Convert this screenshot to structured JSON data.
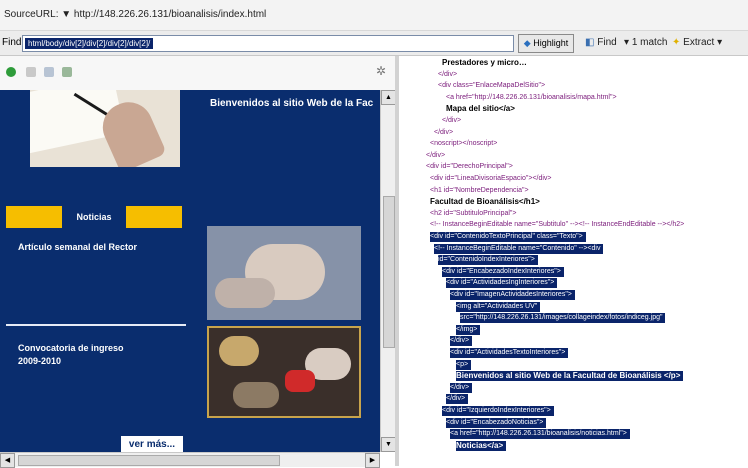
{
  "toolbar": {
    "source_label": "SourceURL: ▼ http://148.226.26.131/bioanalisis/index.html",
    "find_label": "Find",
    "find_value": "html/body/div[2]/div[2]/div[2]/div[2]/",
    "highlight_label": "Highlight",
    "find_button_label": "Find",
    "match_count": "1 match",
    "extract_label": "Extract"
  },
  "site": {
    "welcome": "Bienvenidos al sitio Web de la Fac",
    "news_label": "Noticias",
    "article_title": "Artículo semanal del Rector",
    "convocatoria_line1": "Convocatoria de ingreso",
    "convocatoria_line2": "2009-2010",
    "more_link": "ver más..."
  },
  "source_lines": [
    {
      "text": "Prestadores y micro…",
      "indent": 42,
      "bold": true,
      "hl": false
    },
    {
      "text": "</div>",
      "indent": 38,
      "bold": false,
      "hl": false
    },
    {
      "text": "<div class=\"EnlaceMapaDelSitio\">",
      "indent": 38,
      "bold": false,
      "hl": false
    },
    {
      "text": "<a href=\"http://148.226.26.131/bioanalisis/mapa.html\">",
      "indent": 46,
      "bold": false,
      "hl": false
    },
    {
      "text": "Mapa del sitio</a>",
      "indent": 46,
      "bold": true,
      "hl": false
    },
    {
      "text": "</div>",
      "indent": 42,
      "bold": false,
      "hl": false
    },
    {
      "text": "</div>",
      "indent": 34,
      "bold": false,
      "hl": false
    },
    {
      "text": "<noscript></noscript>",
      "indent": 30,
      "bold": false,
      "hl": false
    },
    {
      "text": "</div>",
      "indent": 26,
      "bold": false,
      "hl": false
    },
    {
      "text": "<div id=\"DerechoPrincipal\">",
      "indent": 26,
      "bold": false,
      "hl": false
    },
    {
      "text": "<div id=\"LineaDivisoriaEspacio\"></div>",
      "indent": 30,
      "bold": false,
      "hl": false
    },
    {
      "text": "<h1 id=\"NombreDependencia\">",
      "indent": 30,
      "bold": false,
      "hl": false
    },
    {
      "text": "Facultad de Bioanálisis</h1>",
      "indent": 30,
      "bold": true,
      "hl": false
    },
    {
      "text": "<h2 id=\"SubtituloPrincipal\">",
      "indent": 30,
      "bold": false,
      "hl": false
    },
    {
      "text": "<!-- InstanceBeginEditable name=\"Subtitulo\" --><!-- InstanceEndEditable --></h2>",
      "indent": 30,
      "bold": false,
      "hl": false
    },
    {
      "text": "<div id=\"ContenidoTextoPrincipal\" class=\"Texto\">",
      "indent": 30,
      "bold": false,
      "hl": true
    },
    {
      "text": "<!-- InstanceBeginEditable name=\"Contenido\" --><div",
      "indent": 34,
      "bold": false,
      "hl": true
    },
    {
      "text": "id=\"ContenidoIndexInteriores\">",
      "indent": 38,
      "bold": false,
      "hl": true
    },
    {
      "text": "<div id=\"EncabezadoIndexInteriores\">",
      "indent": 42,
      "bold": false,
      "hl": true
    },
    {
      "text": "<div id=\"ActividadesIngInteriores\">",
      "indent": 46,
      "bold": false,
      "hl": true
    },
    {
      "text": "<div id=\"ImagenActividadesInteriores\">",
      "indent": 50,
      "bold": false,
      "hl": true
    },
    {
      "text": "<img alt=\"Actividades UV\"",
      "indent": 56,
      "bold": false,
      "hl": true
    },
    {
      "text": "src=\"http://148.226.26.131/images/collageindex/fotos/indiceg.jpg\"",
      "indent": 60,
      "bold": false,
      "hl": true
    },
    {
      "text": "</img>",
      "indent": 56,
      "bold": false,
      "hl": true
    },
    {
      "text": "</div>",
      "indent": 50,
      "bold": false,
      "hl": true
    },
    {
      "text": "<div id=\"ActividadesTextoInteriores\">",
      "indent": 50,
      "bold": false,
      "hl": true
    },
    {
      "text": "<p>",
      "indent": 56,
      "bold": false,
      "hl": true
    },
    {
      "text": "Bienvenidos al sitio Web de la Facultad de Bioanálisis </p>",
      "indent": 56,
      "bold": true,
      "hl": true
    },
    {
      "text": "</div>",
      "indent": 50,
      "bold": false,
      "hl": true
    },
    {
      "text": "</div>",
      "indent": 46,
      "bold": false,
      "hl": true
    },
    {
      "text": "<div id=\"IzquierdoIndexInteriores\">",
      "indent": 42,
      "bold": false,
      "hl": true
    },
    {
      "text": "<div id=\"EncabezadoNoticias\">",
      "indent": 46,
      "bold": false,
      "hl": true
    },
    {
      "text": "<a href=\"http://148.226.26.131/bioanalisis/noticias.html\">",
      "indent": 50,
      "bold": false,
      "hl": true
    },
    {
      "text": "Noticias</a>",
      "indent": 56,
      "bold": true,
      "hl": true
    }
  ]
}
